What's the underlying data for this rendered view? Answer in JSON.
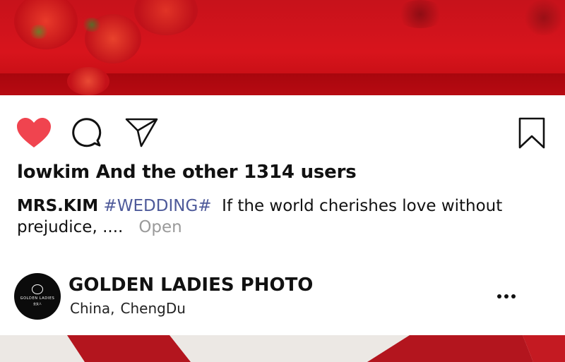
{
  "post": {
    "liked_by": "lowkim And the other 1314 users",
    "caption": {
      "username": "MRS.KIM",
      "hashtag": "#WEDDING#",
      "text": "If the world cherishes love without prejudice, ....",
      "more_label": "Open"
    }
  },
  "account": {
    "name": "GOLDEN LADIES PHOTO",
    "location_country": "China,",
    "location_city": "ChengDu",
    "avatar_text": "GOLDEN LADIES",
    "avatar_subtext": "金女人"
  },
  "icons": {
    "like": "heart-icon",
    "comment": "comment-icon",
    "share": "send-icon",
    "save": "bookmark-icon",
    "more": "more-dots-icon"
  },
  "colors": {
    "like_active": "#f0444f",
    "hashtag": "#4e5a9a",
    "more_link": "#9a9a9a",
    "photo_red": "#d8141c"
  }
}
